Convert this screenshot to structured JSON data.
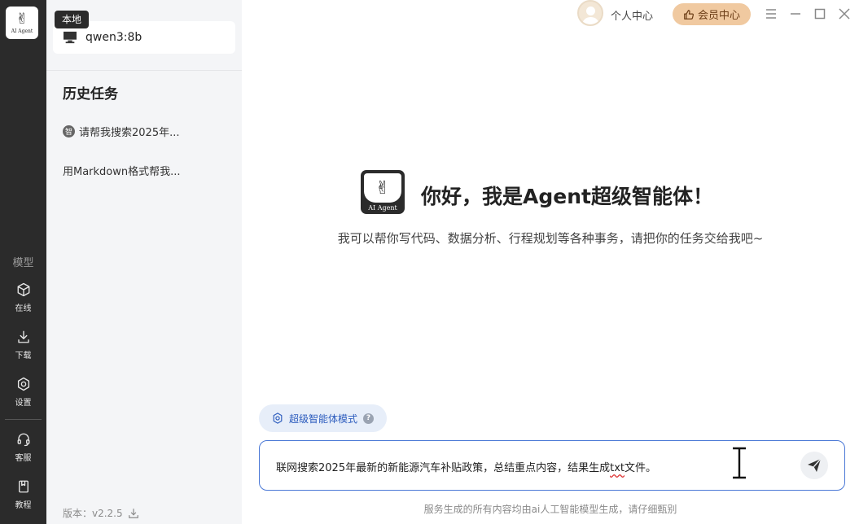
{
  "rail": {
    "logo_text": "AI Agent",
    "section_label": "模型",
    "items": [
      {
        "label": "在线",
        "icon": "cube-icon"
      },
      {
        "label": "下载",
        "icon": "download-icon"
      },
      {
        "label": "设置",
        "icon": "settings-icon"
      },
      {
        "label": "客服",
        "icon": "headset-icon"
      },
      {
        "label": "教程",
        "icon": "book-icon"
      }
    ]
  },
  "panel": {
    "tag": "本地",
    "model_name": "qwen3:8b",
    "history_title": "历史任务",
    "history": [
      {
        "badge": "智",
        "text": "请帮我搜索2025年..."
      },
      {
        "badge": "",
        "text": "用Markdown格式帮我..."
      }
    ],
    "version": "版本：v2.2.5"
  },
  "topbar": {
    "personal_label": "个人中心",
    "vip_label": "会员中心",
    "colors": {
      "vip_bg": "#f0c9a0",
      "vip_text": "#6b3d16"
    }
  },
  "hero": {
    "logo_text": "AI Agent",
    "title": "你好，我是Agent超级智能体！",
    "subtitle": "我可以帮你写代码、数据分析、行程规划等各种事务，请把你的任务交给我吧~"
  },
  "mode": {
    "label": "超级智能体模式",
    "help": "?"
  },
  "input": {
    "value_before": "联网搜索2025年最新的新能源汽车补贴政策，总结重点内容，结果生成",
    "value_underlined": "txt",
    "value_after": "文件。"
  },
  "footer": {
    "disclaimer": "服务生成的所有内容均由ai人工智能模型生成，请仔细甄别"
  },
  "colors": {
    "rail_bg": "#2b2b2b",
    "panel_bg": "#f4f5f7",
    "accent": "#4a78d6",
    "chip_bg": "#e7eef9"
  }
}
